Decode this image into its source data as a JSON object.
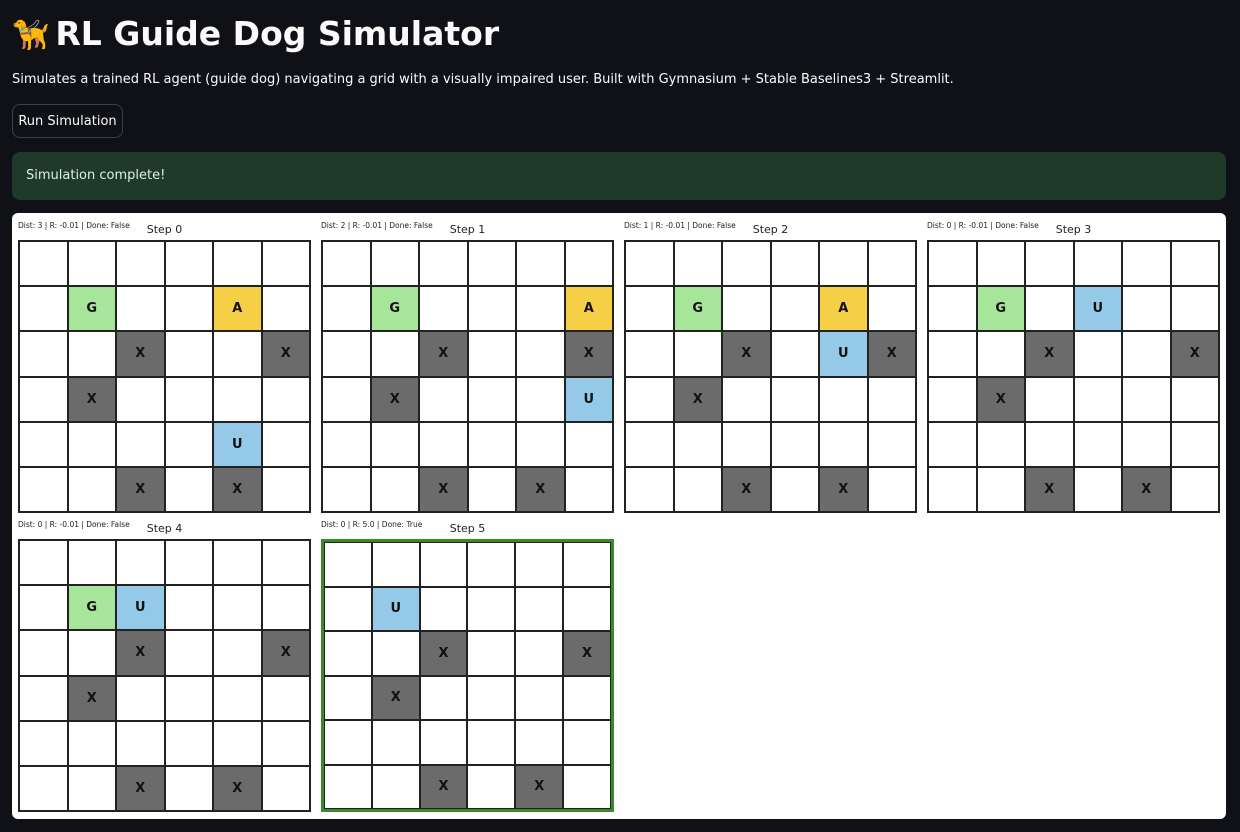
{
  "app": {
    "dog_icon": "🦮",
    "title": "RL Guide Dog Simulator",
    "description": "Simulates a trained RL agent (guide dog) navigating a grid with a visually impaired user. Built with Gymnasium + Stable Baselines3 + Streamlit.",
    "run_button_label": "Run Simulation",
    "status_message": "Simulation complete!"
  },
  "colors": {
    "background": "#0f1117",
    "success_bg": "#203a2a",
    "goal": "#a6e59a",
    "agent": "#f5cf45",
    "user": "#95c9e8",
    "obstacle": "#6b6b6b",
    "done_border": "#3a8a2c"
  },
  "grid_size": 6,
  "legend_letters": {
    "goal": "G",
    "agent": "A",
    "user": "U",
    "obstacle": "X"
  },
  "steps": [
    {
      "title": "Step 0",
      "info": "Dist: 3 | R: -0.01 | Done: False",
      "done": false,
      "goal": [
        1,
        1
      ],
      "agent": [
        1,
        4
      ],
      "user": [
        4,
        4
      ],
      "obstacles": [
        [
          2,
          2
        ],
        [
          2,
          5
        ],
        [
          3,
          1
        ],
        [
          5,
          2
        ],
        [
          5,
          4
        ]
      ]
    },
    {
      "title": "Step 1",
      "info": "Dist: 2 | R: -0.01 | Done: False",
      "done": false,
      "goal": [
        1,
        1
      ],
      "agent": [
        1,
        5
      ],
      "user": [
        3,
        5
      ],
      "obstacles": [
        [
          2,
          2
        ],
        [
          2,
          5
        ],
        [
          3,
          1
        ],
        [
          5,
          2
        ],
        [
          5,
          4
        ]
      ]
    },
    {
      "title": "Step 2",
      "info": "Dist: 1 | R: -0.01 | Done: False",
      "done": false,
      "goal": [
        1,
        1
      ],
      "agent": [
        1,
        4
      ],
      "user": [
        2,
        4
      ],
      "obstacles": [
        [
          2,
          2
        ],
        [
          2,
          5
        ],
        [
          3,
          1
        ],
        [
          5,
          2
        ],
        [
          5,
          4
        ]
      ]
    },
    {
      "title": "Step 3",
      "info": "Dist: 0 | R: -0.01 | Done: False",
      "done": false,
      "goal": [
        1,
        1
      ],
      "agent": null,
      "user": [
        1,
        3
      ],
      "obstacles": [
        [
          2,
          2
        ],
        [
          2,
          5
        ],
        [
          3,
          1
        ],
        [
          5,
          2
        ],
        [
          5,
          4
        ]
      ]
    },
    {
      "title": "Step 4",
      "info": "Dist: 0 | R: -0.01 | Done: False",
      "done": false,
      "goal": [
        1,
        1
      ],
      "agent": null,
      "user": [
        1,
        2
      ],
      "obstacles": [
        [
          2,
          2
        ],
        [
          2,
          5
        ],
        [
          3,
          1
        ],
        [
          5,
          2
        ],
        [
          5,
          4
        ]
      ]
    },
    {
      "title": "Step 5",
      "info": "Dist: 0 | R: 5.0 | Done: True",
      "done": true,
      "goal": null,
      "agent": null,
      "user": [
        1,
        1
      ],
      "obstacles": [
        [
          2,
          2
        ],
        [
          2,
          5
        ],
        [
          3,
          1
        ],
        [
          5,
          2
        ],
        [
          5,
          4
        ]
      ]
    }
  ]
}
